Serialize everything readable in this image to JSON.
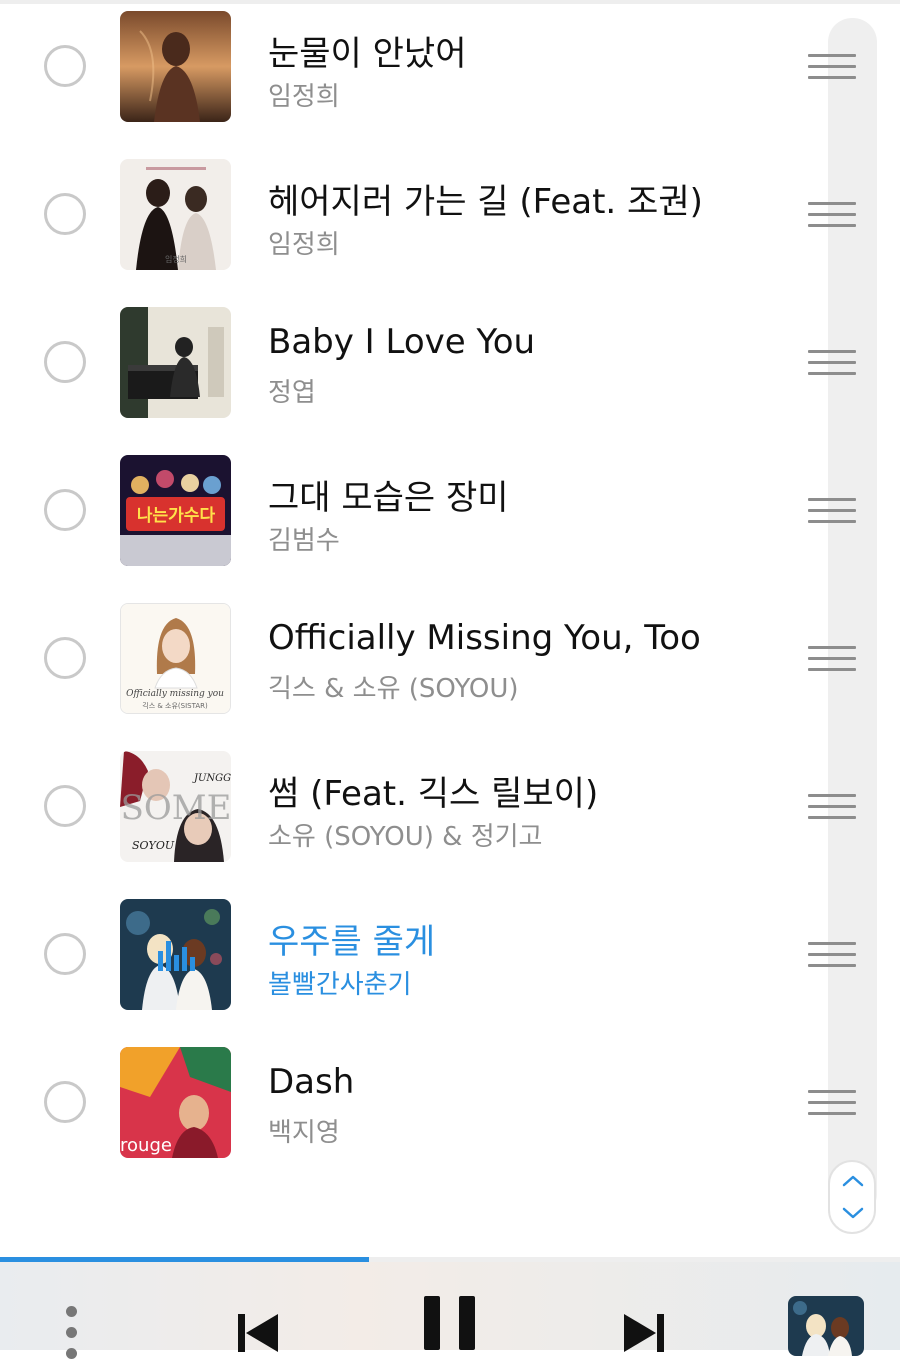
{
  "accent_color": "#2a8fe0",
  "tracks": [
    {
      "title": "눈물이 안났어",
      "artist": "임정희",
      "active": false
    },
    {
      "title": "헤어지러 가는 길 (Feat. 조권)",
      "artist": "임정희",
      "active": false
    },
    {
      "title": "Baby I Love You",
      "artist": "정엽",
      "active": false
    },
    {
      "title": "그대 모습은 장미",
      "artist": "김범수",
      "active": false
    },
    {
      "title": "Officially Missing You, Too",
      "artist": "긱스 & 소유 (SOYOU)",
      "active": false
    },
    {
      "title": "썸 (Feat. 긱스 릴보이)",
      "artist": "소유 (SOYOU) & 정기고",
      "active": false
    },
    {
      "title": "우주를 줄게",
      "artist": "볼빨간사춘기",
      "active": true
    },
    {
      "title": "Dash",
      "artist": "백지영",
      "active": false
    }
  ],
  "album_art": {
    "cover_2": {
      "caption": "임정희"
    },
    "cover_4": {
      "logo": "나는가수다"
    },
    "cover_5": {
      "script": "Officially missing you",
      "caption": "긱스 & 소유(SISTAR)"
    },
    "cover_6": {
      "word": "SOME",
      "signature_1": "JUNGGIGO",
      "signature_2": "SOYOU"
    },
    "cover_8": {
      "word": "rouge"
    }
  },
  "playback": {
    "progress": 0.41,
    "state": "playing"
  },
  "icons": {
    "select": "radio-circle-icon",
    "reorder": "drag-handle-icon",
    "jump": "chevron-up-down-icon",
    "more": "vertical-dots-icon",
    "previous": "skip-previous-icon",
    "pause": "pause-icon",
    "next": "skip-next-icon"
  }
}
